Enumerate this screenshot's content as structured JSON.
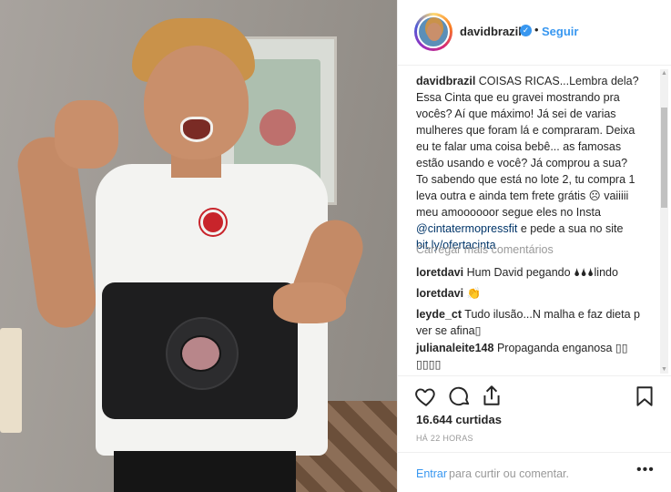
{
  "post": {
    "username": "davidbrazil",
    "verified_icon": "verified-check-icon",
    "separator": "•",
    "follow_label": "Seguir"
  },
  "caption": {
    "author": "davidbrazil",
    "text": "COISAS RICAS...Lembra dela? Essa Cinta que eu gravei mostrando pra vocês? Aí que máximo! Já sei de varias mulheres que foram lá e compraram. Deixa eu te falar uma coisa bebê... as famosas estão usando e você? Já comprou a sua? To sabendo que está no lote 2, tu compra 1 leva outra e ainda tem frete grátis ☹ vaiiiii meu amoooooor segue eles no Insta",
    "mention": "@cintatermopressfit",
    "text2": "e pede a sua no site",
    "link": "bit.ly/ofertacinta"
  },
  "load_more": "Carregar mais comentários",
  "comments": [
    {
      "user": "loretdavi",
      "text": "Hum David pegando 🌢🌢🌢lindo"
    },
    {
      "user": "loretdavi",
      "text": "👏"
    },
    {
      "user": "leyde_ct",
      "text": "Tudo ilusão...N malha e faz dieta p ver se afina▯"
    },
    {
      "user": "julianaleite148",
      "text": "Propaganda enganosa ▯▯ ▯▯▯▯"
    }
  ],
  "likes": "16.644 curtidas",
  "time": "HÁ 22 HORAS",
  "footer": {
    "enter": "Entrar",
    "rest": "para curtir ou comentar.",
    "more": "•••"
  },
  "icons": {
    "like": "heart-icon",
    "comment": "comment-bubble-icon",
    "share": "share-icon",
    "save": "bookmark-icon"
  },
  "colors": {
    "link_blue": "#3897f0",
    "mention_blue": "#003569",
    "muted": "#999999"
  }
}
